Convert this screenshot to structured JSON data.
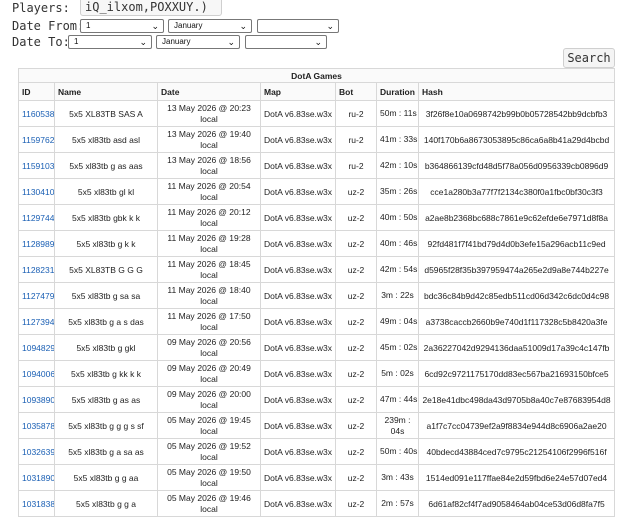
{
  "filters": {
    "players_label": "Players:",
    "players_value": "iQ_ilxom,POXXUY.)",
    "date_from_label": "Date From:",
    "date_to_label": "Date To:",
    "from_day": "1",
    "from_month": "January",
    "from_year": "",
    "to_day": "1",
    "to_month": "January",
    "to_year": ""
  },
  "search_label": "Search",
  "table": {
    "caption": "DotA Games",
    "columns": [
      "ID",
      "Name",
      "Date",
      "Map",
      "Bot",
      "Duration",
      "Hash"
    ],
    "rows": [
      {
        "id": "1160538",
        "name": "5x5 XL83TB SAS A",
        "date1": "13 May 2026 @ 20:23",
        "date2": "local",
        "map": "DotA v6.83se.w3x",
        "bot": "ru-2",
        "dur1": "50m : 11s",
        "dur2": "",
        "hash": "3f26f8e10a0698742b99b0b05728542bb9dcbfb3"
      },
      {
        "id": "1159762",
        "name": "5x5 xl83tb asd asl",
        "date1": "13 May 2026 @ 19:40",
        "date2": "local",
        "map": "DotA v6.83se.w3x",
        "bot": "ru-2",
        "dur1": "41m : 33s",
        "dur2": "",
        "hash": "140f170b6a8673053895c86ca6a8b41a29d4bcbd"
      },
      {
        "id": "1159103",
        "name": "5x5 xl83tb g as aas",
        "date1": "13 May 2026 @ 18:56",
        "date2": "local",
        "map": "DotA v6.83se.w3x",
        "bot": "ru-2",
        "dur1": "42m : 10s",
        "dur2": "",
        "hash": "b364866139cfd48d5f78a056d0956339cb0896d9"
      },
      {
        "id": "1130410",
        "name": "5x5 xl83tb gl kl",
        "date1": "11 May 2026 @ 20:54",
        "date2": "local",
        "map": "DotA v6.83se.w3x",
        "bot": "uz-2",
        "dur1": "35m : 26s",
        "dur2": "",
        "hash": "cce1a280b3a77f7f2134c380f0a1fbc0bf30c3f3"
      },
      {
        "id": "1129744",
        "name": "5x5 xl83tb gbk k k",
        "date1": "11 May 2026 @ 20:12",
        "date2": "local",
        "map": "DotA v6.83se.w3x",
        "bot": "uz-2",
        "dur1": "40m : 50s",
        "dur2": "",
        "hash": "a2ae8b2368bc688c7861e9c62efde6e7971d8f8a"
      },
      {
        "id": "1128989",
        "name": "5x5 xl83tb g k k",
        "date1": "11 May 2026 @ 19:28",
        "date2": "local",
        "map": "DotA v6.83se.w3x",
        "bot": "uz-2",
        "dur1": "40m : 46s",
        "dur2": "",
        "hash": "92fd481f7f41bd79d4d0b3efe15a296acb11c9ed"
      },
      {
        "id": "1128231",
        "name": "5x5 XL83TB G G G",
        "date1": "11 May 2026 @ 18:45",
        "date2": "local",
        "map": "DotA v6.83se.w3x",
        "bot": "uz-2",
        "dur1": "42m : 54s",
        "dur2": "",
        "hash": "d5965f28f35b397959474a265e2d9a8e744b227e"
      },
      {
        "id": "1127479",
        "name": "5x5 xl83tb g sa sa",
        "date1": "11 May 2026 @ 18:40",
        "date2": "local",
        "map": "DotA v6.83se.w3x",
        "bot": "uz-2",
        "dur1": "3m : 22s",
        "dur2": "",
        "hash": "bdc36c84b9d42c85edb511cd06d342c6dc0d4c98"
      },
      {
        "id": "1127394",
        "name": "5x5 xl83tb g a s das",
        "date1": "11 May 2026 @ 17:50",
        "date2": "local",
        "map": "DotA v6.83se.w3x",
        "bot": "uz-2",
        "dur1": "49m : 04s",
        "dur2": "",
        "hash": "a3738caccb2660b9e740d1f117328c5b8420a3fe"
      },
      {
        "id": "1094829",
        "name": "5x5 xl83tb g gkl",
        "date1": "09 May 2026 @ 20:56",
        "date2": "local",
        "map": "DotA v6.83se.w3x",
        "bot": "uz-2",
        "dur1": "45m : 02s",
        "dur2": "",
        "hash": "2a36227042d9294136daa51009d17a39c4c147fb"
      },
      {
        "id": "1094006",
        "name": "5x5 xl83tb g kk k k",
        "date1": "09 May 2026 @ 20:49",
        "date2": "local",
        "map": "DotA v6.83se.w3x",
        "bot": "uz-2",
        "dur1": "5m : 02s",
        "dur2": "",
        "hash": "6cd92c9721175170dd83ec567ba21693150bfce5"
      },
      {
        "id": "1093890",
        "name": "5x5 xl83tb g as as",
        "date1": "09 May 2026 @ 20:00",
        "date2": "local",
        "map": "DotA v6.83se.w3x",
        "bot": "uz-2",
        "dur1": "47m : 44s",
        "dur2": "",
        "hash": "2e18e41dbc498da43d9705b8a40c7e87683954d8"
      },
      {
        "id": "1035878",
        "name": "5x5 xl83tb g g g s sf",
        "date1": "05 May 2026 @ 19:45",
        "date2": "local",
        "map": "DotA v6.83se.w3x",
        "bot": "uz-2",
        "dur1": "239m :",
        "dur2": "04s",
        "hash": "a1f7c7cc04739ef2a9f8834e944d8c6906a2ae20"
      },
      {
        "id": "1032639",
        "name": "5x5 xl83tb g a sa as",
        "date1": "05 May 2026 @ 19:52",
        "date2": "local",
        "map": "DotA v6.83se.w3x",
        "bot": "uz-2",
        "dur1": "50m : 40s",
        "dur2": "",
        "hash": "40bdecd43884ced7c9795c21254106f2996f516f"
      },
      {
        "id": "1031890",
        "name": "5x5 xl83tb g g aa",
        "date1": "05 May 2026 @ 19:50",
        "date2": "local",
        "map": "DotA v6.83se.w3x",
        "bot": "uz-2",
        "dur1": "3m : 43s",
        "dur2": "",
        "hash": "1514ed091e117ffae84e2d59fbd6e24e57d07ed4"
      },
      {
        "id": "1031838",
        "name": "5x5 xl83tb g g a",
        "date1": "05 May 2026 @ 19:46",
        "date2": "local",
        "map": "DotA v6.83se.w3x",
        "bot": "uz-2",
        "dur1": "2m : 57s",
        "dur2": "",
        "hash": "6d61af82cf4f7ad9058464ab04ce53d06d8fa7f5"
      }
    ]
  },
  "colors": {
    "link": "#1a5fb4",
    "border": "#d8d8d8"
  },
  "icons": {
    "select_arrow": "chevron-down-icon"
  }
}
